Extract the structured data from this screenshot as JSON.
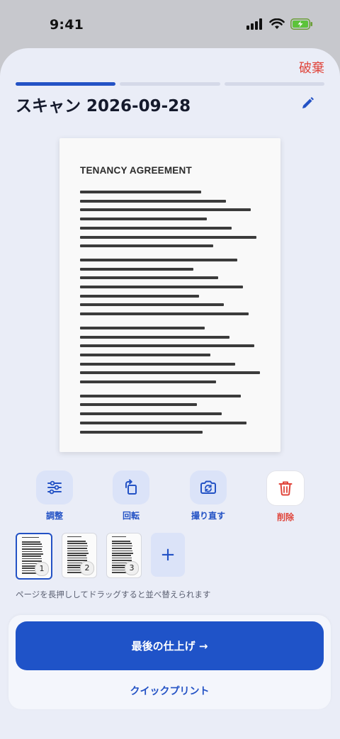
{
  "status": {
    "time": "9:41"
  },
  "header": {
    "discard_label": "破棄",
    "title": "スキャン 2026-09-28"
  },
  "progress": {
    "total_steps": 3,
    "current_step": 1
  },
  "document": {
    "title": "TENANCY AGREEMENT"
  },
  "tools": [
    {
      "label": "調整",
      "icon": "sliders-icon"
    },
    {
      "label": "回転",
      "icon": "rotate-icon"
    },
    {
      "label": "撮り直す",
      "icon": "retake-camera-icon"
    },
    {
      "label": "削除",
      "icon": "trash-icon"
    }
  ],
  "pages": [
    {
      "number": "1",
      "selected": true
    },
    {
      "number": "2",
      "selected": false
    },
    {
      "number": "3",
      "selected": false
    }
  ],
  "add_page_label": "+",
  "hint": "ページを長押ししてドラッグすると並べ替えられます",
  "actions": {
    "finish_label": "最後の仕上げ →",
    "quick_print_label": "クイックプリント"
  },
  "colors": {
    "accent": "#2352c5",
    "danger": "#e0453b",
    "sheet_bg": "#eaedf7"
  }
}
